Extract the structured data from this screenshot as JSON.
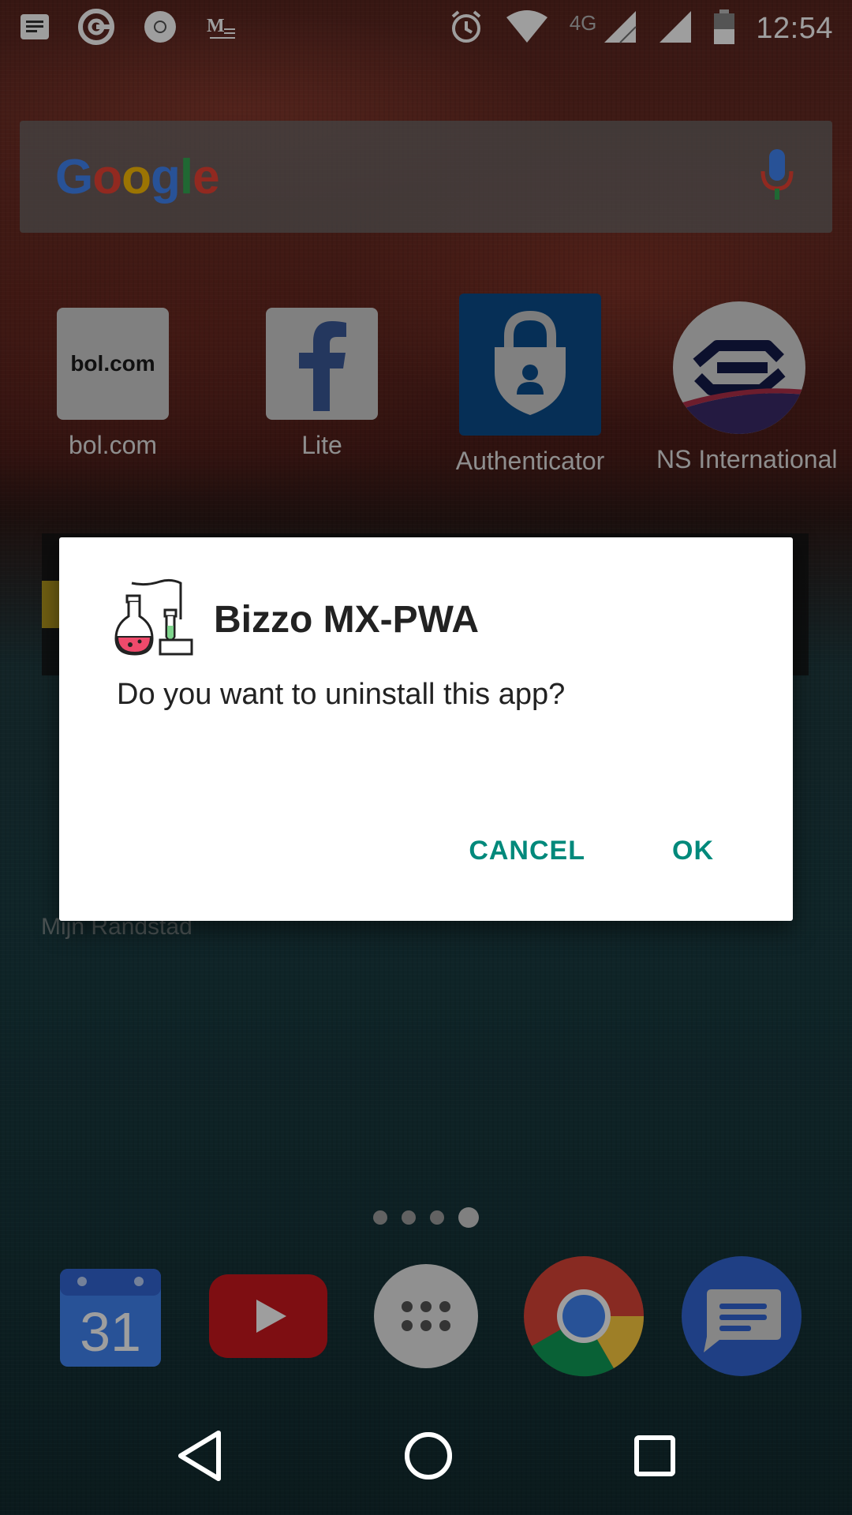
{
  "status_bar": {
    "notifications": [
      "message-notification-icon",
      "ping-app-icon",
      "chrome-icon",
      "medium-icon"
    ],
    "network_label": "4G",
    "time": "12:54"
  },
  "search": {
    "logo_letters": [
      "G",
      "o",
      "o",
      "g",
      "l",
      "e"
    ]
  },
  "apps": [
    {
      "label": "bol.com",
      "logo_text": "bol.com"
    },
    {
      "label": "Lite"
    },
    {
      "label": "Authenticator"
    },
    {
      "label": "NS International"
    }
  ],
  "background_label": "Mijn Randstad",
  "dialog": {
    "title": "Bizzo MX-PWA",
    "message": "Do you want to uninstall this app?",
    "cancel_label": "CANCEL",
    "ok_label": "OK"
  },
  "page_indicator": {
    "count": 4,
    "active_index": 3
  },
  "dock": {
    "calendar_day": "31",
    "items": [
      "calendar-app",
      "youtube-app",
      "app-drawer",
      "chrome-app",
      "messages-app"
    ]
  },
  "colors": {
    "dialog_button": "#00897B",
    "google_blue": "#4285F4",
    "google_red": "#EA4335",
    "google_yellow": "#FBBC05",
    "google_green": "#34A853"
  }
}
